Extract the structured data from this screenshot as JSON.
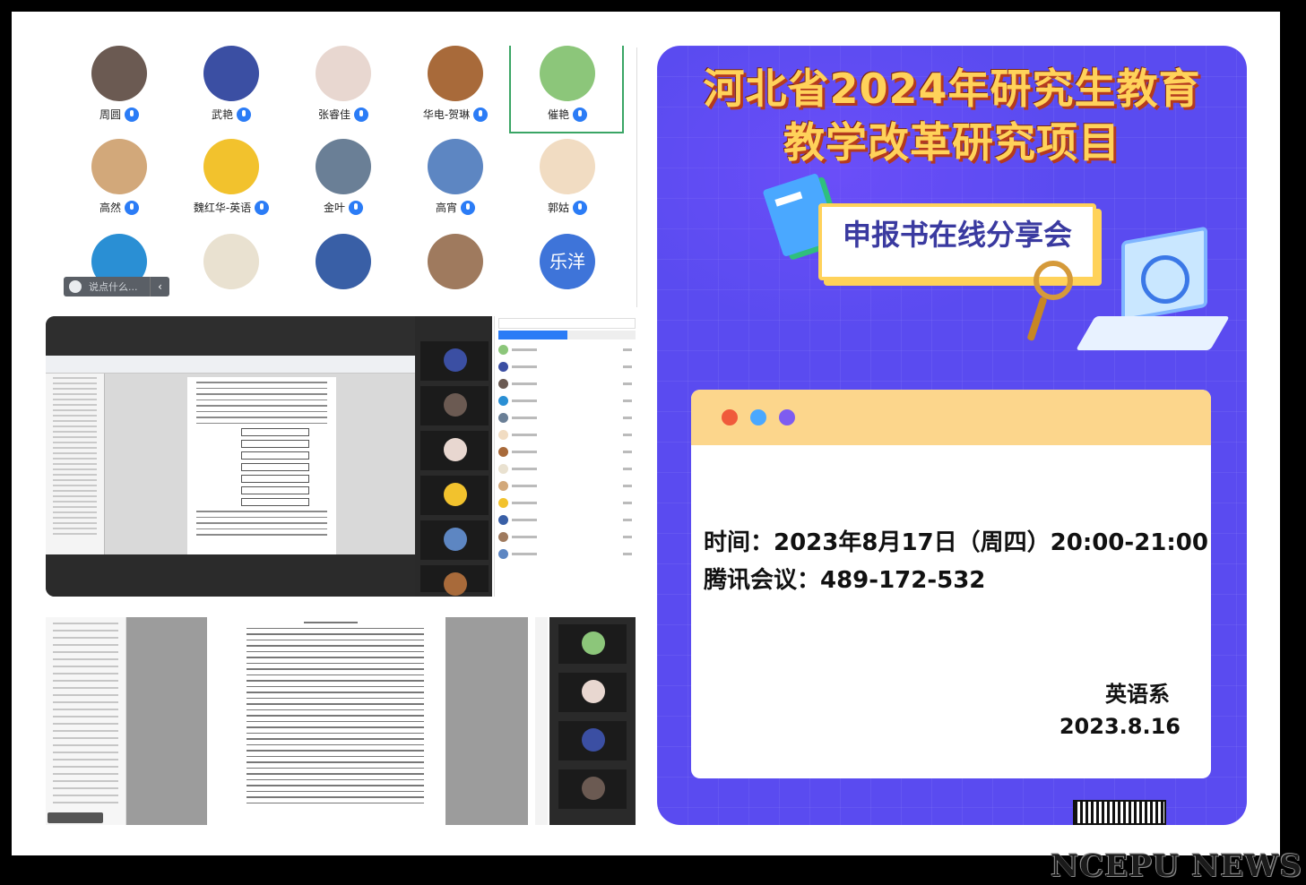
{
  "participants": [
    {
      "name": "周圆",
      "color": "#6b5a52"
    },
    {
      "name": "武艳",
      "color": "#3b4fa3"
    },
    {
      "name": "张睿佳",
      "color": "#e8d7d0"
    },
    {
      "name": "华电-贺琳",
      "color": "#a86a3a"
    },
    {
      "name": "催艳",
      "color": "#8cc67a"
    },
    {
      "name": "高然",
      "color": "#d2a87a"
    },
    {
      "name": "魏红华-英语",
      "color": "#f2c22d"
    },
    {
      "name": "金叶",
      "color": "#6a7f96"
    },
    {
      "name": "高宵",
      "color": "#5d86c2"
    },
    {
      "name": "郭姑",
      "color": "#f1dcc2"
    },
    {
      "name": "",
      "color": "#2a8fd4"
    },
    {
      "name": "",
      "color": "#e9e1d0"
    },
    {
      "name": "",
      "color": "#395fa6"
    },
    {
      "name": "",
      "color": "#9f7a5e"
    },
    {
      "name": "乐洋",
      "color": "#3e74d9"
    }
  ],
  "chat_placeholder": "说点什么...",
  "poster": {
    "title_line1": "河北省2024年研究生教育",
    "title_line2": "教学改革研究项目",
    "subtitle": "申报书在线分享会",
    "time_line": "时间：2023年8月17日（周四）20:00-21:00",
    "meeting_line": "腾讯会议：489-172-532",
    "department": "英语系",
    "date": "2023.8.16",
    "dot_colors": [
      "#f05a3b",
      "#4aa8ff",
      "#7e5cf0"
    ]
  },
  "watermark": "NCEPU NEWS"
}
